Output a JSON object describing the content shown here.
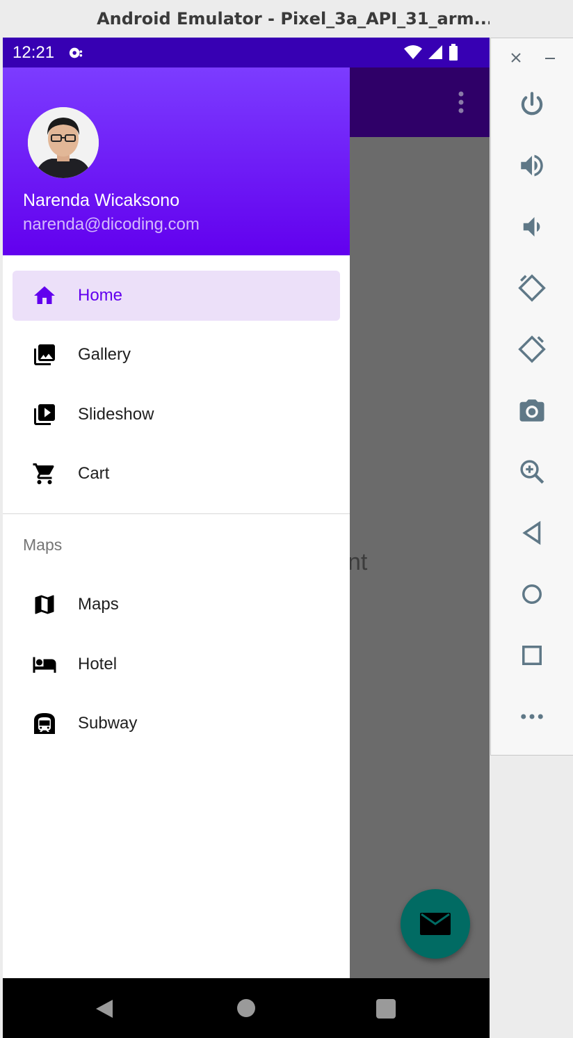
{
  "window": {
    "title": "Android Emulator - Pixel_3a_API_31_arm..."
  },
  "status_bar": {
    "time": "12:21"
  },
  "background": {
    "content_text": "nt"
  },
  "drawer": {
    "header": {
      "name": "Narenda Wicaksono",
      "email": "narenda@dicoding.com"
    },
    "items": [
      {
        "label": "Home",
        "icon": "home-icon",
        "active": true
      },
      {
        "label": "Gallery",
        "icon": "gallery-icon",
        "active": false
      },
      {
        "label": "Slideshow",
        "icon": "slideshow-icon",
        "active": false
      },
      {
        "label": "Cart",
        "icon": "cart-icon",
        "active": false
      }
    ],
    "section": {
      "title": "Maps",
      "items": [
        {
          "label": "Maps",
          "icon": "map-icon"
        },
        {
          "label": "Hotel",
          "icon": "hotel-icon"
        },
        {
          "label": "Subway",
          "icon": "subway-icon"
        }
      ]
    }
  },
  "colors": {
    "primary": "#6200ee",
    "primary_dark": "#3700b3",
    "fab": "#016b63",
    "active_item_bg": "#ece0f9"
  },
  "emulator_controls": [
    "close-icon",
    "minimize-icon",
    "power-icon",
    "volume-up-icon",
    "volume-down-icon",
    "rotate-left-icon",
    "rotate-right-icon",
    "camera-icon",
    "zoom-icon",
    "back-icon",
    "home-icon",
    "overview-icon",
    "more-icon"
  ]
}
